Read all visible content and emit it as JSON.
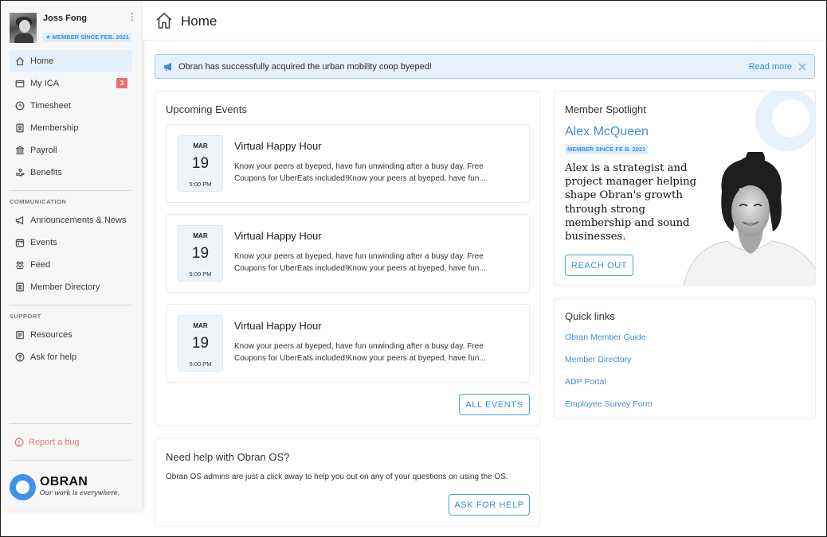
{
  "user": {
    "name": "Joss Fong",
    "member_badge": "★ MEMBER SINCE FEB. 2021"
  },
  "sidebar": {
    "items": [
      {
        "label": "Home",
        "icon": "home-icon",
        "active": true
      },
      {
        "label": "My ICA",
        "icon": "wallet-icon",
        "badge": "3"
      },
      {
        "label": "Timesheet",
        "icon": "clock-icon"
      },
      {
        "label": "Membership",
        "icon": "id-card-icon"
      },
      {
        "label": "Payroll",
        "icon": "bank-icon"
      },
      {
        "label": "Benefits",
        "icon": "hand-heart-icon"
      }
    ],
    "communication_label": "COMMUNICATION",
    "communication_items": [
      {
        "label": "Announcements & News",
        "icon": "megaphone-icon"
      },
      {
        "label": "Events",
        "icon": "calendar-icon"
      },
      {
        "label": "Feed",
        "icon": "people-icon"
      },
      {
        "label": "Member Directory",
        "icon": "contact-book-icon"
      }
    ],
    "support_label": "SUPPORT",
    "support_items": [
      {
        "label": "Resources",
        "icon": "document-icon"
      },
      {
        "label": "Ask for help",
        "icon": "help-circle-icon"
      }
    ],
    "report_bug": "Report a bug",
    "logo_name": "OBRAN",
    "logo_tagline": "Our work is everywhere."
  },
  "header": {
    "title": "Home"
  },
  "announcement": {
    "text": "Obran has successfully acquired the urban mobility coop byeped!",
    "read_more": "Read more"
  },
  "events": {
    "title": "Upcoming Events",
    "items": [
      {
        "month": "MAR",
        "day": "19",
        "time": "5:00 PM",
        "title": "Virtual Happy Hour",
        "desc": "Know your peers at byeped, have fun unwinding after a busy day. Free Coupons for UberEats included!Know your peers at byeped, have fun..."
      },
      {
        "month": "MAR",
        "day": "19",
        "time": "5:00 PM",
        "title": "Virtual Happy Hour",
        "desc": "Know your peers at byeped, have fun unwinding after a busy day. Free Coupons for UberEats included!Know your peers at byeped, have fun..."
      },
      {
        "month": "MAR",
        "day": "19",
        "time": "5:00 PM",
        "title": "Virtual Happy Hour",
        "desc": "Know your peers at byeped, have fun unwinding after a busy day. Free Coupons for UberEats included!Know your peers at byeped, have fun..."
      }
    ],
    "all_events": "ALL EVENTS"
  },
  "help": {
    "title": "Need help with Obran OS?",
    "text": "Obran OS admins are just a click away to help you out on any of your questions on using the OS.",
    "button": "ASK FOR HELP"
  },
  "spotlight": {
    "title": "Member Spotlight",
    "name": "Alex McQueen",
    "badge": "MEMBER SINCE FE B. 2021",
    "quote": "Alex is a strategist and project manager helping shape Obran's growth through strong membership and sound businesses.",
    "button": "REACH OUT"
  },
  "quick_links": {
    "title": "Quick links",
    "items": [
      "Obran Member Guide",
      "Member Directory",
      "ADP Portal",
      "Employee Survey Form"
    ]
  },
  "colors": {
    "accent": "#3d8fd6",
    "active_nav": "#e4f0fb",
    "badge_red": "#ec6e6e",
    "logo_blue": "#3d94ea"
  }
}
